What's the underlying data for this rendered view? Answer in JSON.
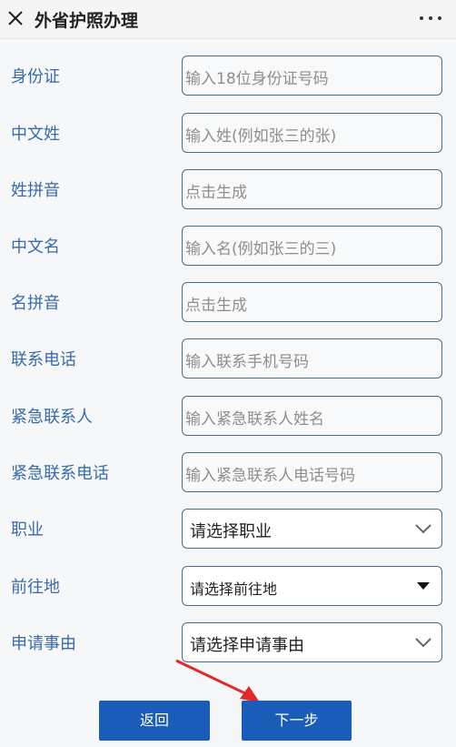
{
  "header": {
    "title": "外省护照办理"
  },
  "form": {
    "fields": [
      {
        "label": "身份证",
        "placeholder": "输入18位身份证号码"
      },
      {
        "label": "中文姓",
        "placeholder": "输入姓(例如张三的张)"
      },
      {
        "label": "姓拼音",
        "placeholder": "点击生成"
      },
      {
        "label": "中文名",
        "placeholder": "输入名(例如张三的三)"
      },
      {
        "label": "名拼音",
        "placeholder": "点击生成"
      },
      {
        "label": "联系电话",
        "placeholder": "输入联系手机号码"
      },
      {
        "label": "紧急联系人",
        "placeholder": "输入紧急联系人姓名"
      },
      {
        "label": "紧急联系电话",
        "placeholder": "输入紧急联系人电话号码"
      }
    ],
    "selects": [
      {
        "label": "职业",
        "value": "请选择职业",
        "icon": "chevron-down-icon"
      },
      {
        "label": "前往地",
        "value": "请选择前往地",
        "icon": "caret-down-icon"
      },
      {
        "label": "申请事由",
        "value": "请选择申请事由",
        "icon": "chevron-down-icon"
      }
    ]
  },
  "buttons": {
    "back": "返回",
    "next": "下一步"
  },
  "colors": {
    "label": "#3b6ba7",
    "button": "#1a5cb8",
    "arrow": "#e02a2a"
  }
}
